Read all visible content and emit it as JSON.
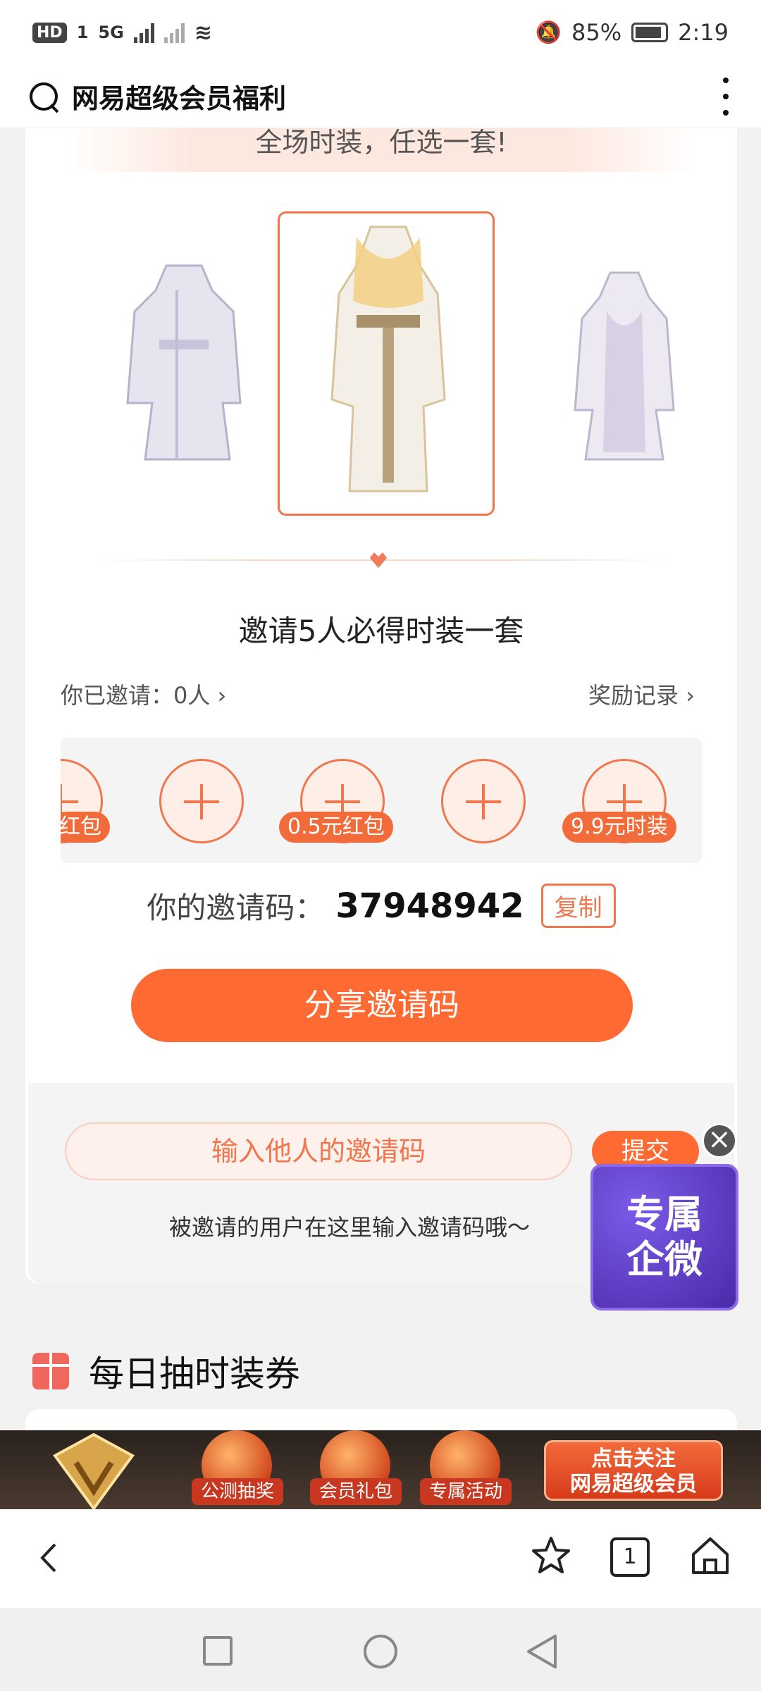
{
  "status_bar": {
    "hd_badge": "HD",
    "sim_index": "1",
    "network": "5G",
    "battery": "85%",
    "time": "2:19"
  },
  "header": {
    "title": "网易超级会员福利"
  },
  "banner": {
    "text": "全场时装，任选一套!"
  },
  "invite": {
    "title": "邀请5人必得时装一套",
    "invited_count": "你已邀请：0人",
    "reward_record": "奖励记录",
    "slots": [
      {
        "badge": "红包"
      },
      {
        "badge": ""
      },
      {
        "badge": "0.5元红包"
      },
      {
        "badge": ""
      },
      {
        "badge": "9.9元时装"
      }
    ],
    "code_label": "你的邀请码：",
    "code_value": "37948942",
    "copy_label": "复制",
    "share_label": "分享邀请码"
  },
  "code_input": {
    "placeholder": "输入他人的邀请码",
    "submit_label": "提交",
    "hint": "被邀请的用户在这里输入邀请码哦～"
  },
  "promo": {
    "line1": "专属",
    "line2": "企微"
  },
  "daily": {
    "title": "每日抽时装券"
  },
  "ad_bar": {
    "items": [
      "公测抽奖",
      "会员礼包",
      "专属活动"
    ],
    "follow_line1": "点击关注",
    "follow_line2": "网易超级会员"
  },
  "browser": {
    "tab_count": "1"
  },
  "colors": {
    "accent": "#ff6a32",
    "accent_border": "#f0764d",
    "promo_purple": "#5b3cc4"
  }
}
